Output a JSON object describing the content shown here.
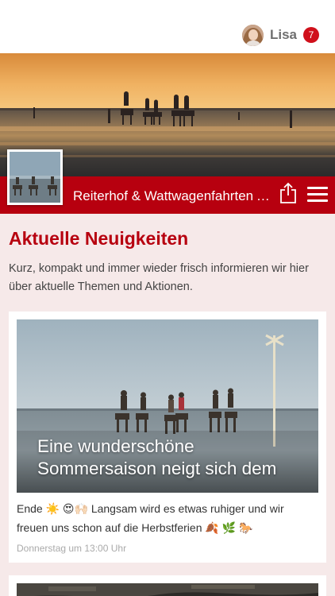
{
  "header": {
    "user_name": "Lisa",
    "notification_count": "7"
  },
  "page": {
    "company_name": "Reiterhof & Wattwagenfahrten Arnold",
    "section_title": "Aktuelle Neuigkeiten",
    "section_description": "Kurz, kompakt und immer wieder frisch informieren wir hier über aktuelle Themen und Aktionen."
  },
  "posts": [
    {
      "image_title": "Eine wunderschöne Sommersaison neigt sich dem",
      "text": "Ende ☀️ 😍🙌🏻 Langsam wird es etwas ruhiger und wir freuen uns schon auf die Herbstferien 🍂 🌿 🐎",
      "date": "Donnerstag um 13:00 Uhr"
    }
  ],
  "colors": {
    "accent": "#b7000f",
    "badge": "#d0101b",
    "background": "#f6e9e9"
  },
  "icons": [
    "share-icon",
    "hamburger-menu-icon"
  ]
}
